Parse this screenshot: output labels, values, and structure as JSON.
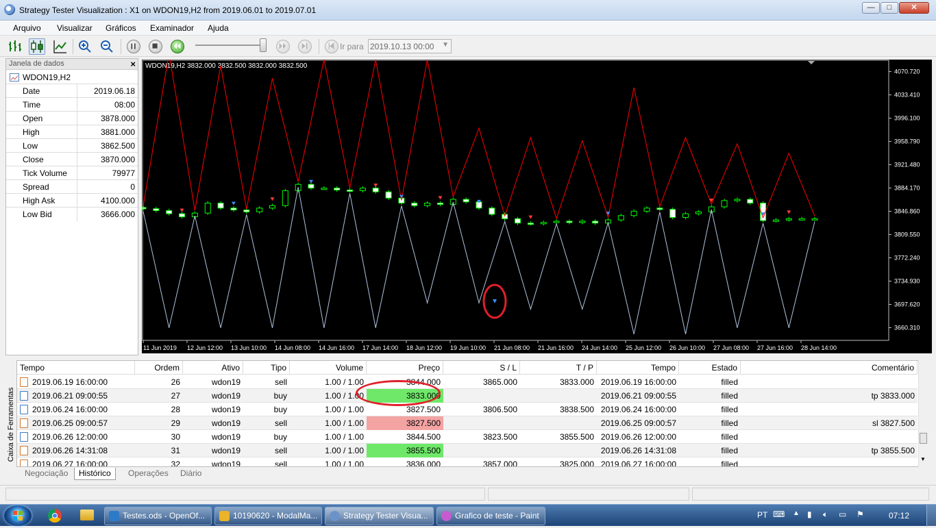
{
  "window": {
    "title": "Strategy Tester Visualization : X1 on WDON19,H2 from 2019.06.01 to 2019.07.01",
    "min_label": "—",
    "max_label": "□",
    "close_label": "✕"
  },
  "menu": [
    "Arquivo",
    "Visualizar",
    "Gráficos",
    "Examinador",
    "Ajuda"
  ],
  "toolbar": {
    "goto_label": "Ir para",
    "goto_value": "2019.10.13 00:00"
  },
  "datawindow": {
    "header": "Janela de dados",
    "close_label": "×",
    "symbol": "WDON19,H2",
    "rows": [
      {
        "k": "Date",
        "v": "2019.06.18"
      },
      {
        "k": "Time",
        "v": "08:00"
      },
      {
        "k": "Open",
        "v": "3878.000"
      },
      {
        "k": "High",
        "v": "3881.000"
      },
      {
        "k": "Low",
        "v": "3862.500"
      },
      {
        "k": "Close",
        "v": "3870.000"
      },
      {
        "k": "Tick Volume",
        "v": "79977"
      },
      {
        "k": "Spread",
        "v": "0"
      },
      {
        "k": "High Ask",
        "v": "4100.000"
      },
      {
        "k": "Low Bid",
        "v": "3666.000"
      }
    ]
  },
  "chart_data": {
    "type": "candlestick",
    "header": "WDON19,H2  3832.000 3832.500 3832.000 3832.500",
    "ylim": [
      3640,
      4090
    ],
    "yticks": [
      "4070.720",
      "4033.410",
      "3996.100",
      "3958.790",
      "3921.480",
      "3884.170",
      "3846.860",
      "3809.550",
      "3772.240",
      "3734.930",
      "3697.620",
      "3660.310"
    ],
    "xticks": [
      "11 Jun 2019",
      "12 Jun 12:00",
      "13 Jun 10:00",
      "14 Jun 08:00",
      "14 Jun 16:00",
      "17 Jun 14:00",
      "18 Jun 12:00",
      "19 Jun 10:00",
      "21 Jun 08:00",
      "21 Jun 16:00",
      "24 Jun 14:00",
      "25 Jun 12:00",
      "26 Jun 10:00",
      "27 Jun 08:00",
      "27 Jun 16:00",
      "28 Jun 14:00"
    ],
    "closes": [
      3851,
      3848,
      3843,
      3838,
      3844,
      3860,
      3852,
      3849,
      3846,
      3852,
      3856,
      3880,
      3890,
      3884,
      3884,
      3881,
      3880,
      3884,
      3878,
      3868,
      3860,
      3856,
      3860,
      3858,
      3866,
      3862,
      3852,
      3842,
      3835,
      3828,
      3827,
      3829,
      3831,
      3829,
      3831,
      3828,
      3833,
      3840,
      3847,
      3852,
      3850,
      3837,
      3843,
      3846,
      3854,
      3864,
      3866,
      3860,
      3832,
      3833,
      3835,
      3835,
      3835
    ],
    "high_ask_peaks": [
      4100,
      4080,
      4060,
      4090,
      4090,
      4090,
      3980,
      3965,
      3960,
      4045,
      3965,
      3955,
      3940
    ],
    "low_bid_troughs": [
      3660,
      3660,
      3660,
      3660,
      3660,
      3700,
      3700,
      3690,
      3690,
      3650,
      3650,
      3660,
      3660
    ],
    "colors": {
      "bull": "#00ff00",
      "bear": "#ffffff",
      "ask": "#ff0000",
      "bid": "#b0c4de"
    }
  },
  "table": {
    "headers": [
      "Tempo",
      "Ordem",
      "Ativo",
      "Tipo",
      "Volume",
      "Preço",
      "S / L",
      "T / P",
      "Tempo",
      "Estado",
      "Comentário"
    ],
    "rows": [
      {
        "tempo": "2019.06.19 16:00:00",
        "ordem": "26",
        "ativo": "wdon19",
        "tipo": "sell",
        "volume": "1.00 / 1.00",
        "preco": "3844.000",
        "sl": "3865.000",
        "tp": "3833.000",
        "tempo2": "2019.06.19 16:00:00",
        "estado": "filled",
        "comentario": "",
        "hl": ""
      },
      {
        "tempo": "2019.06.21 09:00:55",
        "ordem": "27",
        "ativo": "wdon19",
        "tipo": "buy",
        "volume": "1.00 / 1.00",
        "preco": "3833.000",
        "sl": "",
        "tp": "",
        "tempo2": "2019.06.21 09:00:55",
        "estado": "filled",
        "comentario": "tp 3833.000",
        "hl": "green"
      },
      {
        "tempo": "2019.06.24 16:00:00",
        "ordem": "28",
        "ativo": "wdon19",
        "tipo": "buy",
        "volume": "1.00 / 1.00",
        "preco": "3827.500",
        "sl": "3806.500",
        "tp": "3838.500",
        "tempo2": "2019.06.24 16:00:00",
        "estado": "filled",
        "comentario": "",
        "hl": ""
      },
      {
        "tempo": "2019.06.25 09:00:57",
        "ordem": "29",
        "ativo": "wdon19",
        "tipo": "sell",
        "volume": "1.00 / 1.00",
        "preco": "3827.500",
        "sl": "",
        "tp": "",
        "tempo2": "2019.06.25 09:00:57",
        "estado": "filled",
        "comentario": "sl 3827.500",
        "hl": "red"
      },
      {
        "tempo": "2019.06.26 12:00:00",
        "ordem": "30",
        "ativo": "wdon19",
        "tipo": "buy",
        "volume": "1.00 / 1.00",
        "preco": "3844.500",
        "sl": "3823.500",
        "tp": "3855.500",
        "tempo2": "2019.06.26 12:00:00",
        "estado": "filled",
        "comentario": "",
        "hl": ""
      },
      {
        "tempo": "2019.06.26 14:31:08",
        "ordem": "31",
        "ativo": "wdon19",
        "tipo": "sell",
        "volume": "1.00 / 1.00",
        "preco": "3855.500",
        "sl": "",
        "tp": "",
        "tempo2": "2019.06.26 14:31:08",
        "estado": "filled",
        "comentario": "tp 3855.500",
        "hl": "green"
      },
      {
        "tempo": "2019.06.27 16:00:00",
        "ordem": "32",
        "ativo": "wdon19",
        "tipo": "sell",
        "volume": "1.00 / 1.00",
        "preco": "3836.000",
        "sl": "3857.000",
        "tp": "3825.000",
        "tempo2": "2019.06.27 16:00:00",
        "estado": "filled",
        "comentario": "",
        "hl": ""
      }
    ]
  },
  "toolbox_label": "Caixa de Ferramentas",
  "tabs": [
    "Negociação",
    "Histórico",
    "Operações",
    "Diário"
  ],
  "taskbar": {
    "tasks": [
      "Testes.ods - OpenOf...",
      "10190620 - ModalMa...",
      "Strategy Tester Visua...",
      "Grafico de teste - Paint"
    ],
    "lang": "PT",
    "clock": "07:12"
  }
}
